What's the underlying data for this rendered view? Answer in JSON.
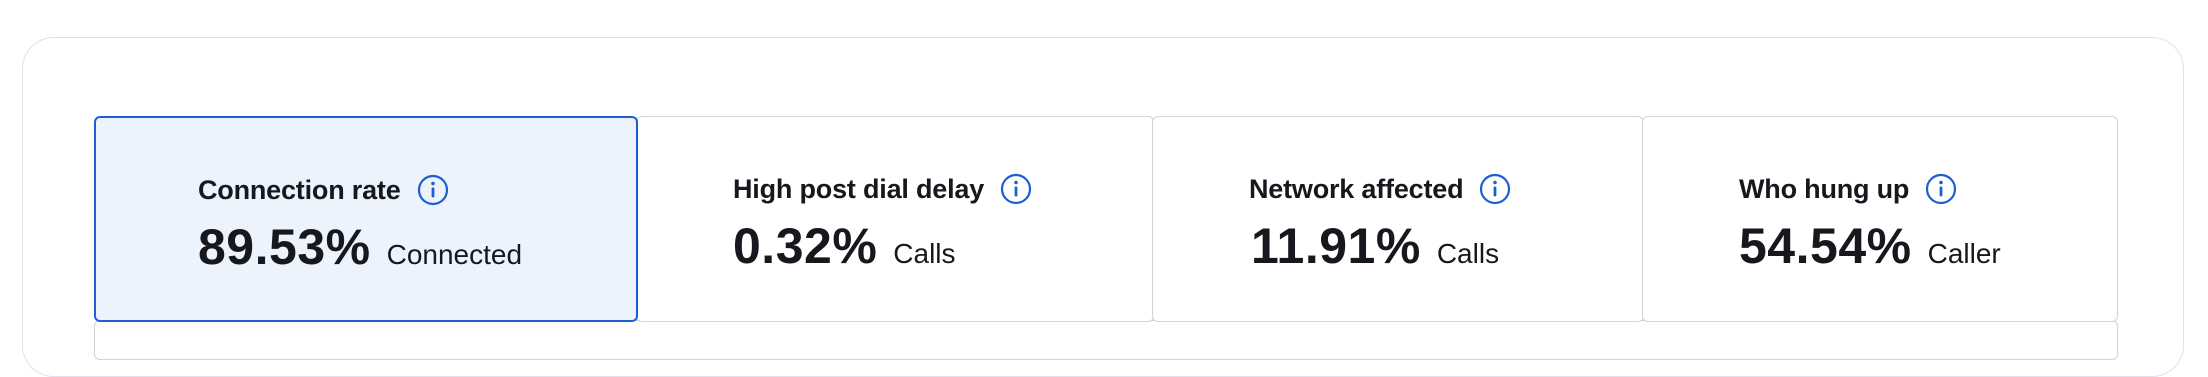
{
  "colors": {
    "accent": "#1d5fd1",
    "selected_background": "#ecf3fd",
    "text": "#16181d",
    "border": "#cfd3da"
  },
  "metrics": [
    {
      "title": "Connection rate",
      "value": "89.53%",
      "unit": "Connected",
      "selected": true,
      "icon": "info-icon"
    },
    {
      "title": "High post dial delay",
      "value": "0.32%",
      "unit": "Calls",
      "selected": false,
      "icon": "info-icon"
    },
    {
      "title": "Network affected",
      "value": "11.91%",
      "unit": "Calls",
      "selected": false,
      "icon": "info-icon"
    },
    {
      "title": "Who hung up",
      "value": "54.54%",
      "unit": "Caller",
      "selected": false,
      "icon": "info-icon"
    }
  ]
}
